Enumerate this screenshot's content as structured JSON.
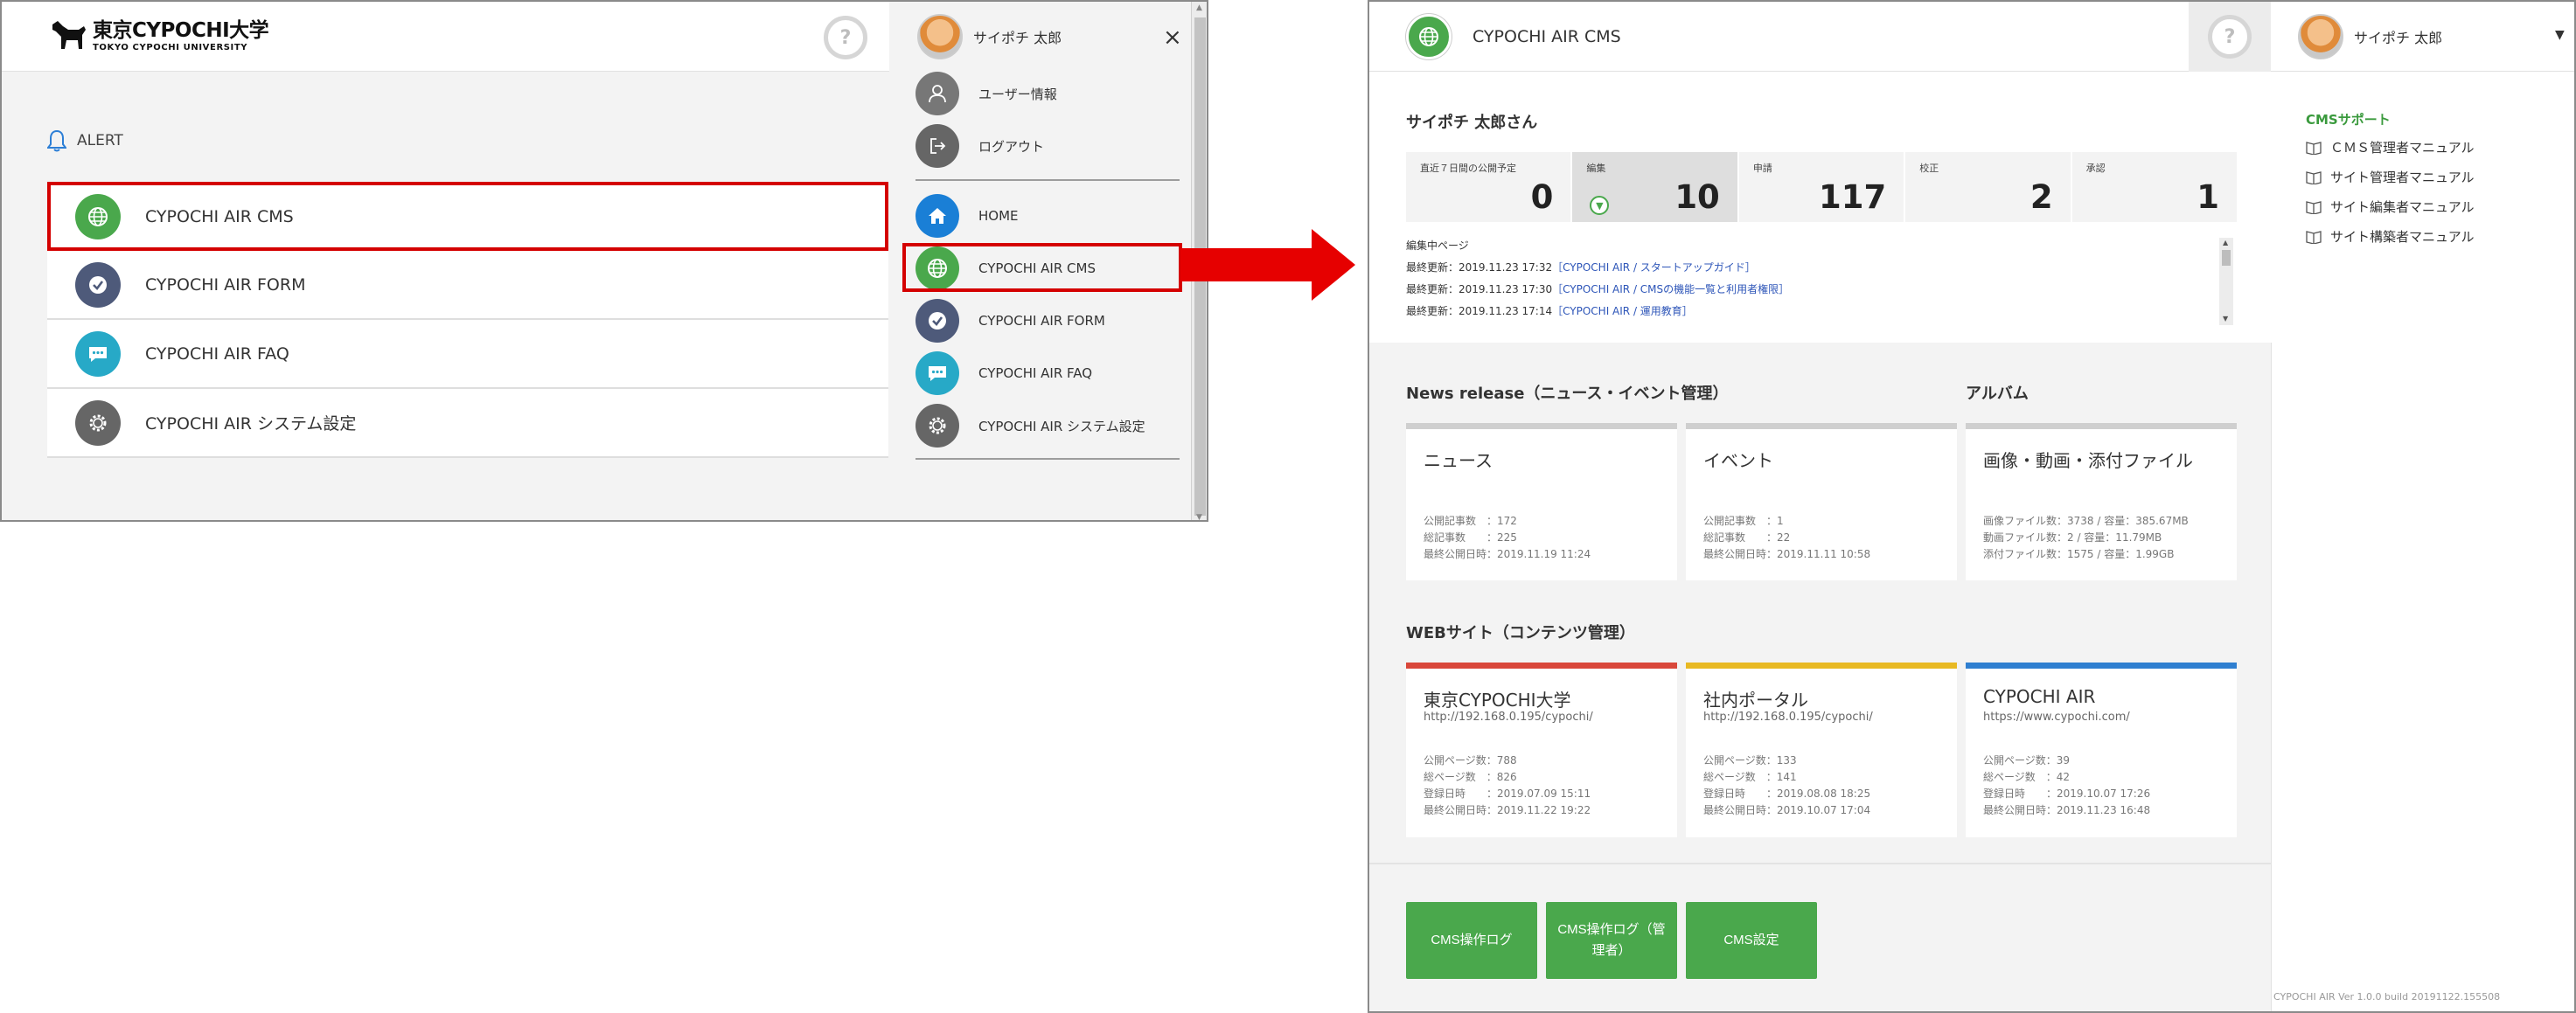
{
  "left": {
    "logo": {
      "name": "東京CYPOCHI大学",
      "sub": "TOKYO CYPOCHI UNIVERSITY"
    },
    "help": "?",
    "alert": "ALERT",
    "menu": [
      {
        "label": "CYPOCHI AIR CMS",
        "icon": "globe-icon"
      },
      {
        "label": "CYPOCHI AIR FORM",
        "icon": "check-icon"
      },
      {
        "label": "CYPOCHI AIR FAQ",
        "icon": "chat-icon"
      },
      {
        "label": "CYPOCHI AIR システム設定",
        "icon": "gear-icon"
      }
    ],
    "drawer": {
      "user": "サイポチ 太郎",
      "close": "×",
      "items": [
        {
          "label": "ユーザー情報",
          "icon": "user-icon"
        },
        {
          "label": "ログアウト",
          "icon": "logout-icon"
        },
        {
          "label": "HOME",
          "icon": "home-icon"
        },
        {
          "label": "CYPOCHI AIR CMS",
          "icon": "globe-icon"
        },
        {
          "label": "CYPOCHI AIR FORM",
          "icon": "check-icon"
        },
        {
          "label": "CYPOCHI AIR FAQ",
          "icon": "chat-icon"
        },
        {
          "label": "CYPOCHI AIR システム設定",
          "icon": "gear-icon"
        }
      ]
    }
  },
  "right": {
    "app_title": "CYPOCHI AIR CMS",
    "help": "?",
    "user": "サイポチ 太郎",
    "caret": "▼",
    "greeting": "サイポチ 太郎さん",
    "stats": [
      {
        "label": "直近７日間の公開予定",
        "value": "0"
      },
      {
        "label": "編集",
        "value": "10"
      },
      {
        "label": "申請",
        "value": "117"
      },
      {
        "label": "校正",
        "value": "2"
      },
      {
        "label": "承認",
        "value": "1"
      }
    ],
    "editing": {
      "title": "編集中ページ",
      "rows": [
        {
          "date": "最終更新：2019.11.23 17:32",
          "link": "［CYPOCHI AIR / スタートアップガイド］"
        },
        {
          "date": "最終更新：2019.11.23 17:30",
          "link": "［CYPOCHI AIR / CMSの機能一覧と利用者権限］"
        },
        {
          "date": "最終更新：2019.11.23 17:14",
          "link": "［CYPOCHI AIR / 運用教育］"
        }
      ]
    },
    "news_section": "News release（ニュース・イベント管理）",
    "album_section": "アルバム",
    "news_cards": [
      {
        "title": "ニュース",
        "stats": "公開記事数　：172\n総記事数　　：225\n最終公開日時：2019.11.19 11:24"
      },
      {
        "title": "イベント",
        "stats": "公開記事数　：1\n総記事数　　：22\n最終公開日時：2019.11.11 10:58"
      },
      {
        "title": "画像・動画・添付ファイル",
        "stats": "画像ファイル数：3738 / 容量：385.67MB\n動画ファイル数：2 / 容量：11.79MB\n添付ファイル数：1575 / 容量：1.99GB"
      }
    ],
    "web_section": "WEBサイト（コンテンツ管理）",
    "site_cards": [
      {
        "title": "東京CYPOCHI大学",
        "url": "http://192.168.0.195/cypochi/",
        "stats": "公開ページ数：788\n総ページ数　：826\n登録日時　　：2019.07.09 15:11\n最終公開日時：2019.11.22 19:22",
        "color": "#d9473a"
      },
      {
        "title": "社内ポータル",
        "url": "http://192.168.0.195/cypochi/",
        "stats": "公開ページ数：133\n総ページ数　：141\n登録日時　　：2019.08.08 18:25\n最終公開日時：2019.10.07 17:04",
        "color": "#e8b923"
      },
      {
        "title": "CYPOCHI AIR",
        "url": "https://www.cypochi.com/",
        "stats": "公開ページ数：39\n総ページ数　：42\n登録日時　　：2019.10.07 17:26\n最終公開日時：2019.11.23 16:48",
        "color": "#2f7fd0"
      }
    ],
    "buttons": [
      "CMS操作ログ",
      "CMS操作ログ（管理者）",
      "CMS設定"
    ],
    "support": {
      "title": "CMSサポート",
      "items": [
        "ＣＭＳ管理者マニュアル",
        "サイト管理者マニュアル",
        "サイト編集者マニュアル",
        "サイト構築者マニュアル"
      ]
    },
    "version": "CYPOCHI AIR Ver 1.0.0 build 20191122.155508"
  },
  "colors": {
    "highlight": "#d40000",
    "accent_green": "#4aa84c"
  }
}
